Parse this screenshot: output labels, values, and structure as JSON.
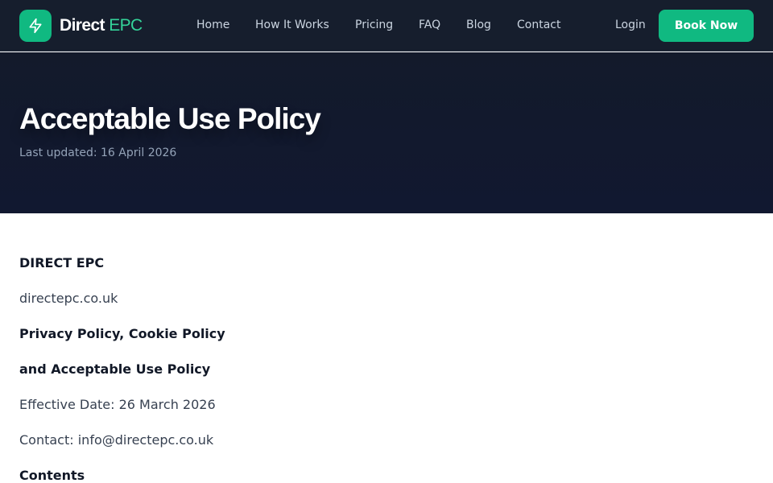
{
  "brand": {
    "name_primary": "Direct",
    "name_accent": "EPC",
    "icon": "lightning-bolt-icon",
    "accent_color": "#10b981"
  },
  "nav": {
    "items": [
      {
        "label": "Home"
      },
      {
        "label": "How It Works"
      },
      {
        "label": "Pricing"
      },
      {
        "label": "FAQ"
      },
      {
        "label": "Blog"
      },
      {
        "label": "Contact"
      }
    ],
    "login_label": "Login",
    "cta_label": "Book Now"
  },
  "hero": {
    "title": "Acceptable Use Policy",
    "updated": "Last updated: 16 April 2026"
  },
  "content": {
    "lines": [
      {
        "text": "DIRECT EPC",
        "bold": true
      },
      {
        "text": "directepc.co.uk",
        "bold": false
      },
      {
        "text": "Privacy Policy, Cookie Policy",
        "bold": true
      },
      {
        "text": "and Acceptable Use Policy",
        "bold": true
      },
      {
        "text": "Effective Date: 26 March 2026",
        "bold": false
      },
      {
        "text": "Contact: info@directepc.co.uk",
        "bold": false
      },
      {
        "text": "Contents",
        "bold": true
      }
    ]
  }
}
